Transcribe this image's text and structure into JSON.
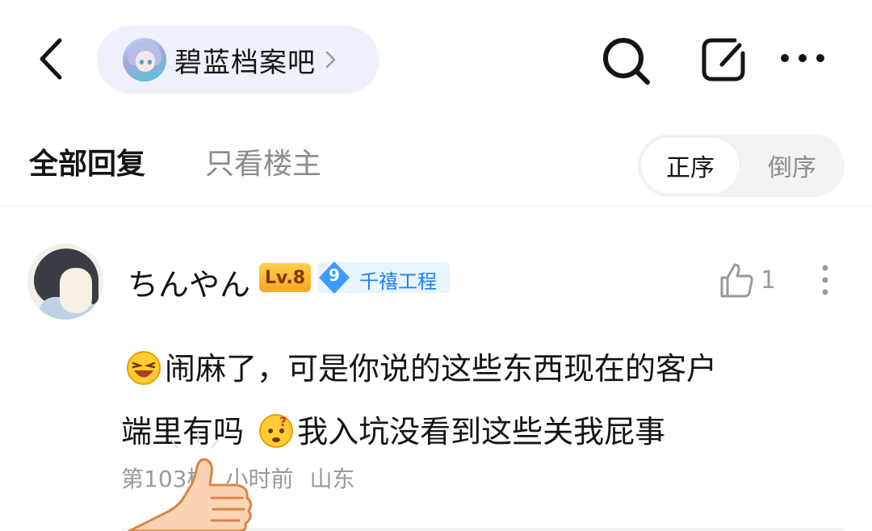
{
  "header": {
    "forum_name": "碧蓝档案吧",
    "icons": [
      "back-arrow-icon",
      "search-icon",
      "share-icon",
      "more-icon"
    ]
  },
  "tabs": {
    "all": "全部回复",
    "owner_only": "只看楼主"
  },
  "sort": {
    "asc": "正序",
    "desc": "倒序"
  },
  "reply": {
    "username": "ちんやん",
    "level": "Lv.8",
    "badge_level": "9",
    "badge_title": "千禧工程",
    "likes": "1",
    "content_line1": "闹麻了，可是你说的这些东西现在的客户",
    "content_line2a": "端里有吗 ",
    "content_line2b": "我入坑没看到这些关我屁事",
    "floor": "第103楼",
    "time": "小时前",
    "location": "山东"
  },
  "colors": {
    "pill_bg": "#eef1fb",
    "badge_blue": "#1c7ef0",
    "level_orange": "#f6a623",
    "muted_text": "#9a9a9a"
  }
}
